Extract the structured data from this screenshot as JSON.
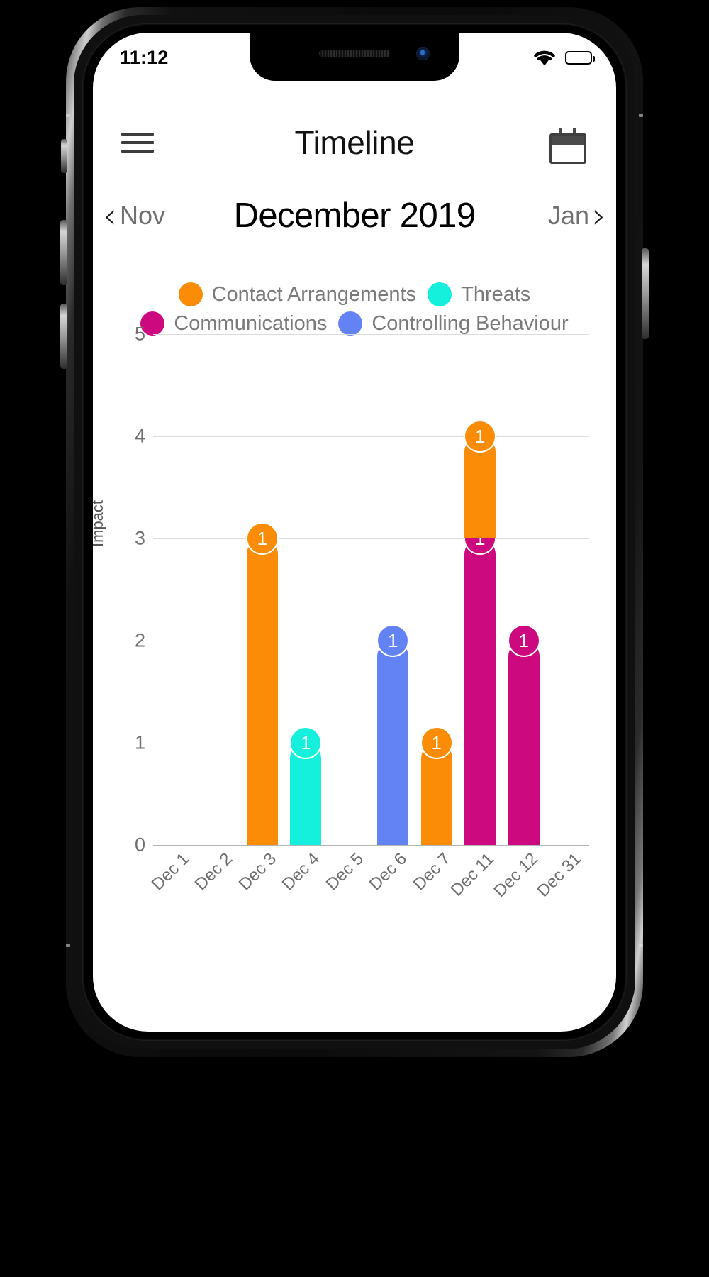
{
  "status_bar": {
    "time": "11:12",
    "wifi_icon": "wifi-icon",
    "battery_icon": "battery-full-icon"
  },
  "header": {
    "menu_icon": "hamburger-menu-icon",
    "title": "Timeline",
    "calendar_icon": "calendar-icon"
  },
  "month_nav": {
    "prev_chevron": "‹",
    "prev_label": "Nov",
    "current": "December 2019",
    "next_label": "Jan",
    "next_chevron": "›"
  },
  "legend": {
    "rows": [
      [
        {
          "label": "Contact Arrangements",
          "color": "#FA8C08"
        },
        {
          "label": "Threats",
          "color": "#14F0DC"
        }
      ],
      [
        {
          "label": "Communications",
          "color": "#CC097F"
        },
        {
          "label": "Controlling Behaviour",
          "color": "#6383F5"
        }
      ]
    ]
  },
  "chart_data": {
    "type": "bar",
    "title": "",
    "xlabel": "",
    "ylabel": "Impact",
    "ylim": [
      0,
      5
    ],
    "yticks": [
      0,
      1,
      2,
      3,
      4,
      5
    ],
    "grid": true,
    "legend_position": "top",
    "stacked": true,
    "categories": [
      "Dec 1",
      "Dec 2",
      "Dec 3",
      "Dec 4",
      "Dec 5",
      "Dec 6",
      "Dec 7",
      "Dec 11",
      "Dec 12",
      "Dec 31"
    ],
    "series": [
      {
        "name": "Contact Arrangements",
        "color": "#FA8C08",
        "values": [
          0,
          0,
          3,
          0,
          0,
          0,
          1,
          1,
          0,
          0
        ]
      },
      {
        "name": "Threats",
        "color": "#14F0DC",
        "values": [
          0,
          0,
          0,
          1,
          0,
          0,
          0,
          0,
          0,
          0
        ]
      },
      {
        "name": "Communications",
        "color": "#CC097F",
        "values": [
          0,
          0,
          0,
          0,
          0,
          0,
          0,
          3,
          2,
          0
        ]
      },
      {
        "name": "Controlling Behaviour",
        "color": "#6383F5",
        "values": [
          0,
          0,
          0,
          0,
          0,
          2,
          0,
          0,
          0,
          0
        ]
      }
    ],
    "bars": [
      {
        "category": "Dec 3",
        "series": "Contact Arrangements",
        "color": "#FA8C08",
        "base": 0,
        "top": 3,
        "badge": "1"
      },
      {
        "category": "Dec 4",
        "series": "Threats",
        "color": "#14F0DC",
        "base": 0,
        "top": 1,
        "badge": "1"
      },
      {
        "category": "Dec 6",
        "series": "Controlling Behaviour",
        "color": "#6383F5",
        "base": 0,
        "top": 2,
        "badge": "1"
      },
      {
        "category": "Dec 7",
        "series": "Contact Arrangements",
        "color": "#FA8C08",
        "base": 0,
        "top": 1,
        "badge": "1"
      },
      {
        "category": "Dec 11",
        "series": "Communications",
        "color": "#CC097F",
        "base": 0,
        "top": 3,
        "badge": "1"
      },
      {
        "category": "Dec 11",
        "series": "Contact Arrangements",
        "color": "#FA8C08",
        "base": 3,
        "top": 4,
        "badge": "1"
      },
      {
        "category": "Dec 12",
        "series": "Communications",
        "color": "#CC097F",
        "base": 0,
        "top": 2,
        "badge": "1"
      }
    ]
  }
}
